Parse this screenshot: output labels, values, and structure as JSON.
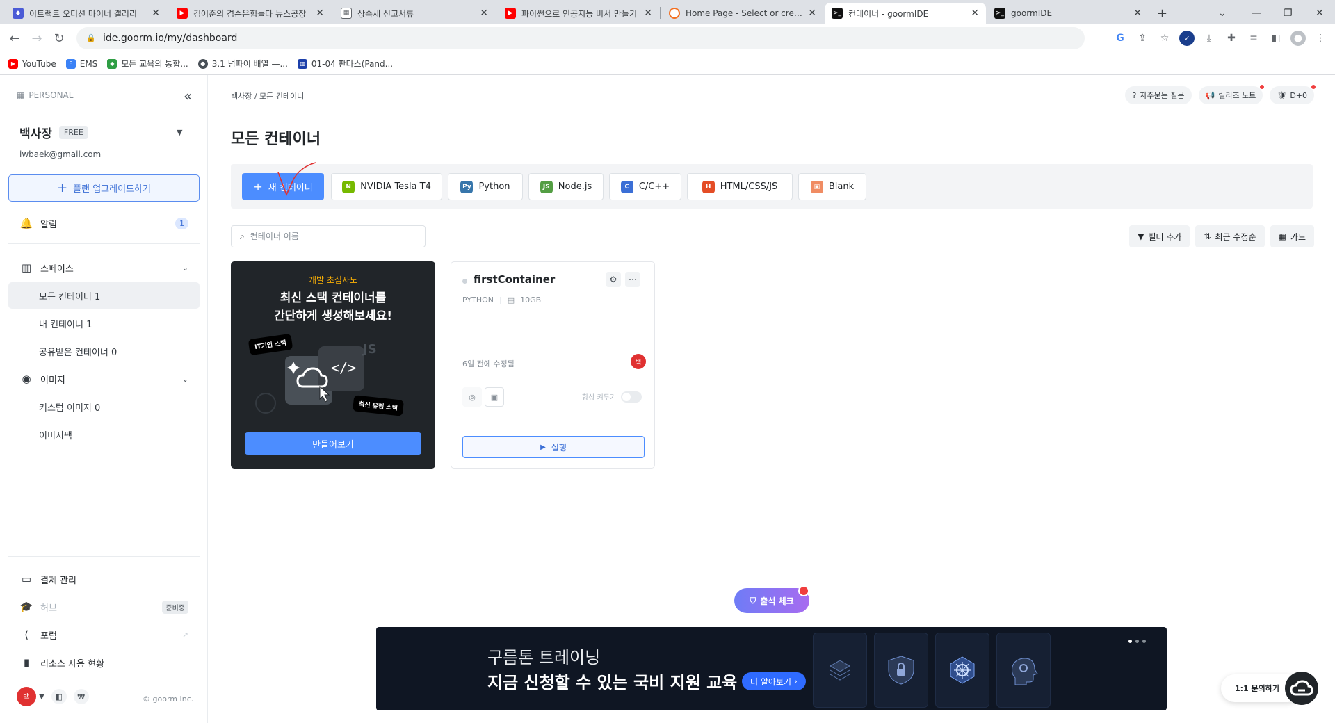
{
  "browser": {
    "tabs": [
      {
        "title": "이트랙트 오디션 마이너 갤러리",
        "color": "#4b5bd6",
        "glyph": "◆"
      },
      {
        "title": "김어준의 겸손은힘들다 뉴스공장",
        "color": "#ff0000",
        "glyph": "▶"
      },
      {
        "title": "상속세 신고서류",
        "color": "#5f6368",
        "glyph": "▦"
      },
      {
        "title": "파이썬으로 인공지능 비서 만들기",
        "color": "#ff0000",
        "glyph": "▶"
      },
      {
        "title": "Home Page - Select or create",
        "color": "#f37021",
        "glyph": "◐"
      },
      {
        "title": "컨테이너 - goormIDE",
        "color": "#111111",
        "glyph": ">_"
      },
      {
        "title": "goormIDE",
        "color": "#111111",
        "glyph": ">_"
      }
    ],
    "url": "ide.goorm.io/my/dashboard",
    "bookmarks": [
      {
        "label": "YouTube",
        "color": "#ff0000",
        "glyph": "▶"
      },
      {
        "label": "EMS",
        "color": "#3b82f6",
        "glyph": "E"
      },
      {
        "label": "모든 교육의 통합...",
        "color": "#2f9e44",
        "glyph": "◆"
      },
      {
        "label": "3.1 넘파이 배열 —...",
        "color": "#495057",
        "glyph": "●"
      },
      {
        "label": "01-04 판다스(Pand...",
        "color": "#1c3faa",
        "glyph": "▥"
      }
    ]
  },
  "sidebar": {
    "workspace_label": "PERSONAL",
    "user_name": "백사장",
    "plan": "FREE",
    "email": "iwbaek@gmail.com",
    "upgrade_label": "플랜 업그레이드하기",
    "notifications": {
      "label": "알림",
      "count": "1"
    },
    "space": {
      "label": "스페이스",
      "items": [
        "모든 컨테이너 1",
        "내 컨테이너 1",
        "공유받은 컨테이너 0"
      ]
    },
    "image": {
      "label": "이미지",
      "items": [
        "커스텀 이미지 0",
        "이미지팩"
      ]
    },
    "billing_label": "결제 관리",
    "hub_label": "허브",
    "hub_badge": "준비중",
    "forum_label": "포럼",
    "resource_label": "리소스 사용 현황",
    "avatar_initial": "백",
    "copyright": "© goorm Inc."
  },
  "main": {
    "breadcrumb": "백사장  /  모든 컨테이너",
    "top_actions": [
      "자주묻는 질문",
      "릴리즈 노트",
      "D+0"
    ],
    "title": "모든 컨테이너",
    "new_container_label": "새 컨테이너",
    "stacks": [
      {
        "label": "NVIDIA Tesla T4",
        "color": "#76b900",
        "glyph": "N"
      },
      {
        "label": "Python",
        "color": "#3776ab",
        "glyph": "Py"
      },
      {
        "label": "Node.js",
        "color": "#539e43",
        "glyph": "JS"
      },
      {
        "label": "C/C++",
        "color": "#3b6fd6",
        "glyph": "C"
      },
      {
        "label": "HTML/CSS/JS",
        "color": "#e44d26",
        "glyph": "H"
      },
      {
        "label": "Blank",
        "color": "#f08c63",
        "glyph": "▣"
      }
    ],
    "search_placeholder": "컨테이너 이름",
    "filters": {
      "add": "필터 추가",
      "sort": "최근 수정순",
      "view": "카드"
    }
  },
  "promo": {
    "eyebrow": "개발 초심자도",
    "title_line1": "최신 스택 컨테이너를",
    "title_line2": "간단하게 생성해보세요!",
    "tag1": "IT기업 스택",
    "tag2": "최신 유행 스택",
    "cta": "만들어보기"
  },
  "container": {
    "name": "firstContainer",
    "stack": "PYTHON",
    "storage": "10GB",
    "modified": "6일 전에 수정됨",
    "owner_initial": "백",
    "keep_alive_label": "항상 켜두기",
    "run_label": "실행"
  },
  "checkin_label": "출석 체크",
  "banner": {
    "line1": "구름톤 트레이닝",
    "line2": "지금 신청할 수 있는 국비 지원 교육",
    "cta": "더 알아보기"
  },
  "inquiry_label": "1:1 문의하기"
}
